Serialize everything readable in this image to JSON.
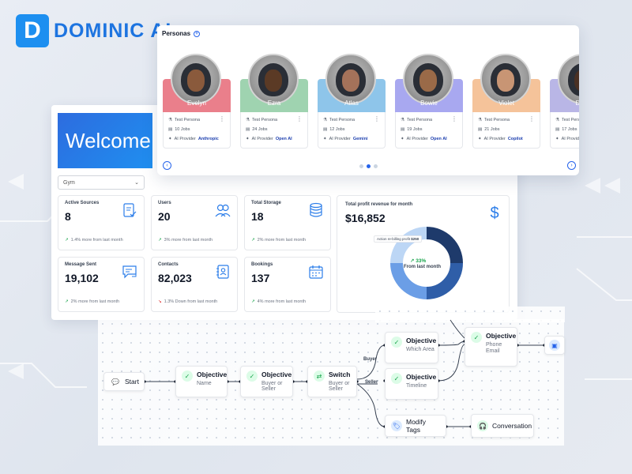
{
  "brand": {
    "name": "DOMINIC AI",
    "mark": "D"
  },
  "personas": {
    "title": "Personas",
    "items": [
      {
        "name": "Evelyn",
        "color": "#ea7f8b",
        "skin": "#8a5a3c",
        "persona": "Test Persona",
        "jobs": "10 Jobs",
        "provider_label": "AI Provider",
        "provider": "Anthropic"
      },
      {
        "name": "Ezra",
        "color": "#9fd3b0",
        "skin": "#5b3a25",
        "persona": "Test Persona",
        "jobs": "24 Jobs",
        "provider_label": "AI Provider",
        "provider": "Open AI"
      },
      {
        "name": "Atlas",
        "color": "#8ec5ea",
        "skin": "#a4725a",
        "persona": "Test Persona",
        "jobs": "12 Jobs",
        "provider_label": "AI Provider",
        "provider": "Gemini"
      },
      {
        "name": "Bowie",
        "color": "#a8a8f0",
        "skin": "#9a6a48",
        "persona": "Test Persona",
        "jobs": "19 Jobs",
        "provider_label": "AI Provider",
        "provider": "Open AI"
      },
      {
        "name": "Violet",
        "color": "#f5c39a",
        "skin": "#c89574",
        "persona": "Test Persona",
        "jobs": "21 Jobs",
        "provider_label": "AI Provider",
        "provider": "Copilot"
      },
      {
        "name": "Desm",
        "color": "#b9b6e6",
        "skin": "#4a3023",
        "persona": "Test Pers",
        "jobs": "17 Jobs",
        "provider_label": "AI Provid",
        "provider": ""
      }
    ]
  },
  "dashboard": {
    "welcome": "Welcome",
    "select": "Gym",
    "stats": [
      {
        "label": "Active Sources",
        "value": "8",
        "trend": "1.4% more from last month",
        "direction": "up",
        "icon": "document-check-icon"
      },
      {
        "label": "Users",
        "value": "20",
        "trend": "3% more from last month",
        "direction": "up",
        "icon": "users-icon"
      },
      {
        "label": "Total Storage",
        "value": "18",
        "trend": "2% more from last month",
        "direction": "up",
        "icon": "database-icon"
      },
      {
        "label": "Message Sent",
        "value": "19,102",
        "trend": "2% more from last month",
        "direction": "up",
        "icon": "message-send-icon"
      },
      {
        "label": "Contacts",
        "value": "82,023",
        "trend": "1.3% Down from last month",
        "direction": "down",
        "icon": "contact-book-icon"
      },
      {
        "label": "Bookings",
        "value": "137",
        "trend": "4% more from last month",
        "direction": "up",
        "icon": "calendar-icon"
      }
    ],
    "revenue": {
      "label": "Total profit revenue for month",
      "value": "$16,852",
      "tooltip_label": "Action re-billing profit",
      "tooltip_value": "$250",
      "center_percent": "33%",
      "center_label": "From last month",
      "segments": [
        {
          "value": 25,
          "color": "#1e3a6b"
        },
        {
          "value": 25,
          "color": "#2f5ea8"
        },
        {
          "value": 25,
          "color": "#6b9ee6"
        },
        {
          "value": 25,
          "color": "#bcd6f5"
        }
      ]
    }
  },
  "flow": {
    "nodes": {
      "start": {
        "title": "Start"
      },
      "obj_name": {
        "title": "Objective",
        "sub": "Name"
      },
      "obj_buyer_seller": {
        "title": "Objective",
        "sub": "Buyer or Seller"
      },
      "switch": {
        "title": "Switch",
        "sub": "Buyer or Seller"
      },
      "obj_area": {
        "title": "Objective",
        "sub": "Which Area"
      },
      "obj_timeline": {
        "title": "Objective",
        "sub": "Timeline"
      },
      "obj_phone": {
        "title": "Objective",
        "sub": "Phone",
        "sub2": "Email"
      },
      "modify_tags": {
        "title": "Modify Tags"
      },
      "conversation": {
        "title": "Conversation"
      }
    },
    "labels": {
      "buyer": "Buyer",
      "seller": "Seller"
    }
  }
}
